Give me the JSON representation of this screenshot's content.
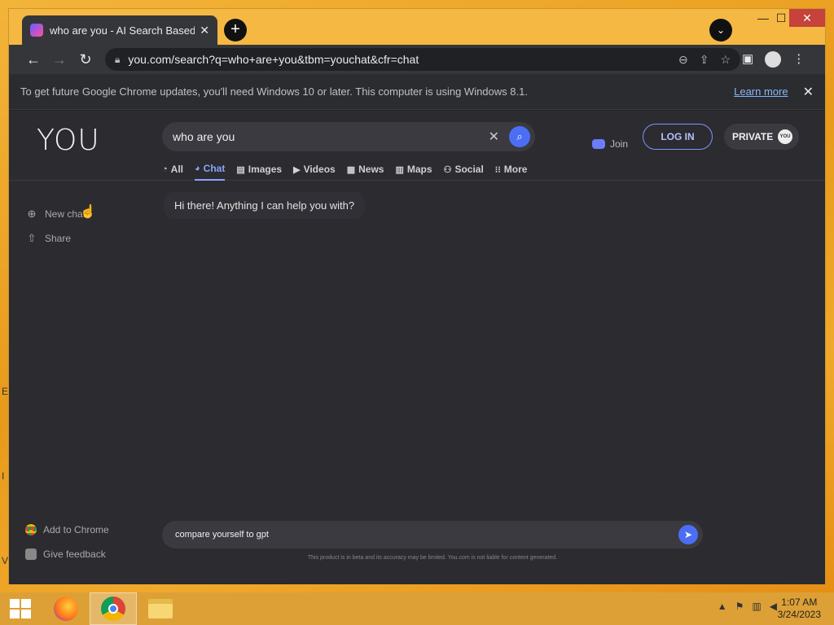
{
  "tab": {
    "title": "who are you - AI Search Based Chat",
    "close": "✕"
  },
  "window": {
    "minimize": "—",
    "maximize": "☐",
    "close": "✕"
  },
  "toolbar": {
    "url": "you.com/search?q=who+are+you&tbm=youchat&cfr=chat"
  },
  "infobar": {
    "text": "To get future Google Chrome updates, you'll need Windows 10 or later. This computer is using Windows 8.1.",
    "link": "Learn more"
  },
  "header": {
    "logo": "YOU",
    "search_value": "who are you",
    "join": "Join",
    "login": "LOG IN",
    "private": "PRIVATE",
    "private_badge": "YOU"
  },
  "nav_tabs": [
    {
      "label": "All",
      "icon": "◔"
    },
    {
      "label": "Chat",
      "icon": "◕",
      "active": true
    },
    {
      "label": "Images",
      "icon": "▤"
    },
    {
      "label": "Videos",
      "icon": "▶"
    },
    {
      "label": "News",
      "icon": "▦"
    },
    {
      "label": "Maps",
      "icon": "▥"
    },
    {
      "label": "Social",
      "icon": "⚇"
    },
    {
      "label": "More",
      "icon": "⁝⁝"
    }
  ],
  "sidebar": {
    "new_chat": "New chat",
    "share": "Share",
    "add_chrome": "Add to Chrome",
    "feedback": "Give feedback"
  },
  "chat": {
    "greeting": "Hi there! Anything I can help you with?"
  },
  "composer": {
    "value": "compare yourself to gpt",
    "disclaimer": "This product is in beta and its accuracy may be limited. You.com is not liable for content generated."
  },
  "taskbar": {
    "time": "1:07 AM",
    "date": "3/24/2023"
  }
}
